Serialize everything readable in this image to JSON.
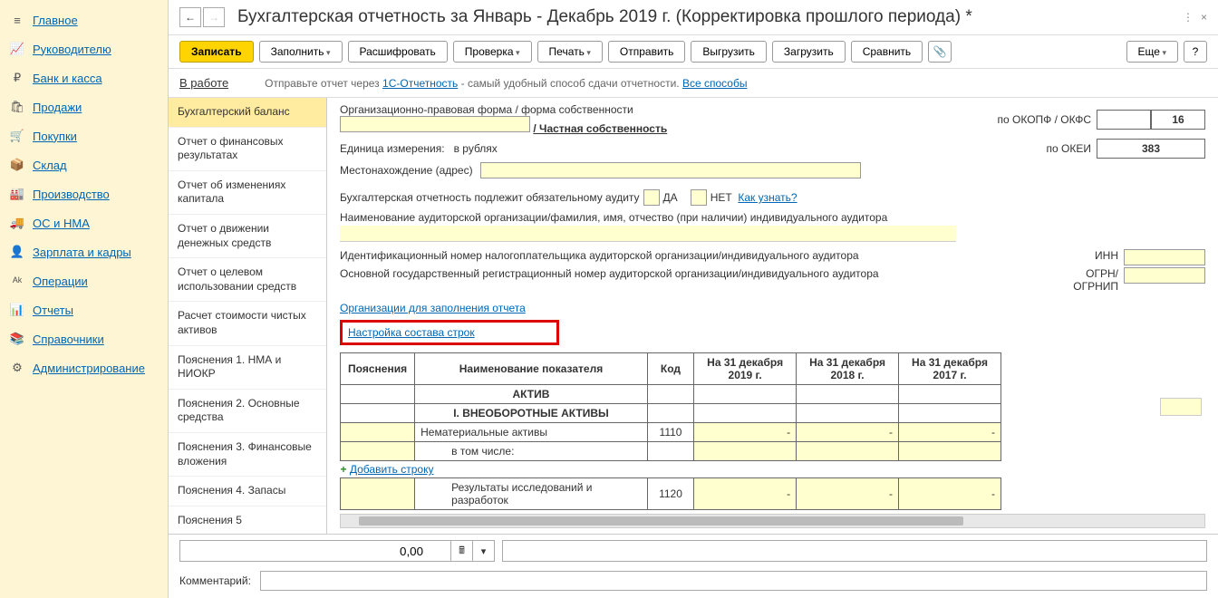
{
  "sidebar": {
    "items": [
      {
        "icon": "≡",
        "label": "Главное"
      },
      {
        "icon": "📈",
        "label": "Руководителю"
      },
      {
        "icon": "₽",
        "label": "Банк и касса"
      },
      {
        "icon": "🛍",
        "label": "Продажи"
      },
      {
        "icon": "🛒",
        "label": "Покупки"
      },
      {
        "icon": "📦",
        "label": "Склад"
      },
      {
        "icon": "🏭",
        "label": "Производство"
      },
      {
        "icon": "🚚",
        "label": "ОС и НМА"
      },
      {
        "icon": "👤",
        "label": "Зарплата и кадры"
      },
      {
        "icon": "ᴬᵏ",
        "label": "Операции"
      },
      {
        "icon": "📊",
        "label": "Отчеты"
      },
      {
        "icon": "📚",
        "label": "Справочники"
      },
      {
        "icon": "⚙",
        "label": "Администрирование"
      }
    ]
  },
  "title": "Бухгалтерская отчетность за Январь - Декабрь 2019 г. (Корректировка прошлого периода) *",
  "toolbar": {
    "write": "Записать",
    "fill": "Заполнить",
    "decode": "Расшифровать",
    "check": "Проверка",
    "print": "Печать",
    "send": "Отправить",
    "upload": "Выгрузить",
    "load": "Загрузить",
    "compare": "Сравнить",
    "more": "Еще",
    "help": "?"
  },
  "status": {
    "in_work": "В работе",
    "send_via": "Отправьте отчет через",
    "onec": "1С-Отчетность",
    "tail": " - самый удобный способ сдачи отчетности. ",
    "all": "Все способы"
  },
  "reportNav": [
    "Бухгалтерский баланс",
    "Отчет о финансовых результатах",
    "Отчет об изменениях капитала",
    "Отчет о движении денежных средств",
    "Отчет о целевом использовании средств",
    "Расчет стоимости чистых активов",
    "Пояснения 1. НМА и НИОКР",
    "Пояснения 2. Основные средства",
    "Пояснения 3. Финансовые вложения",
    "Пояснения 4. Запасы",
    "Пояснения 5"
  ],
  "form": {
    "org_form": "Организационно-правовая форма / форма собственности",
    "ownership_link": "/ Частная собственность",
    "okpf_label": "по ОКОПФ / ОКФС",
    "okpf_val": "16",
    "unit_label": "Единица измерения:",
    "unit_val": "в рублях",
    "okei_label": "по ОКЕИ",
    "okei_val": "383",
    "location": "Местонахождение (адрес)",
    "audit_text": "Бухгалтерская отчетность подлежит обязательному аудиту",
    "yes": "ДА",
    "no": "НЕТ",
    "how": "Как узнать?",
    "auditor_name": "Наименование аудиторской организации/фамилия, имя, отчество (при наличии) индивидуального аудитора",
    "id_num": "Идентификационный номер налогоплательщика аудиторской организации/индивидуального аудитора",
    "inn": "ИНН",
    "ogrn_text": "Основной государственный регистрационный номер аудиторской организации/индивидуального аудитора",
    "ogrn": "ОГРН/\nОГРНИП",
    "org_fill_link": "Организации для заполнения отчета",
    "rows_config": "Настройка состава строк"
  },
  "table": {
    "h_expl": "Пояснения",
    "h_name": "Наименование показателя",
    "h_code": "Код",
    "h_y1": "На 31 декабря 2019 г.",
    "h_y2": "На 31 декабря 2018 г.",
    "h_y3": "На 31 декабря 2017 г.",
    "aktiv": "АКТИВ",
    "section1": "I. ВНЕОБОРОТНЫЕ АКТИВЫ",
    "row1_name": "Нематериальные активы",
    "row1_code": "1110",
    "incl": "в том числе:",
    "add_row": "Добавить строку",
    "row2_name": "Результаты исследований и разработок",
    "row2_code": "1120"
  },
  "bottom": {
    "value": "0,00",
    "comment_label": "Комментарий:"
  }
}
